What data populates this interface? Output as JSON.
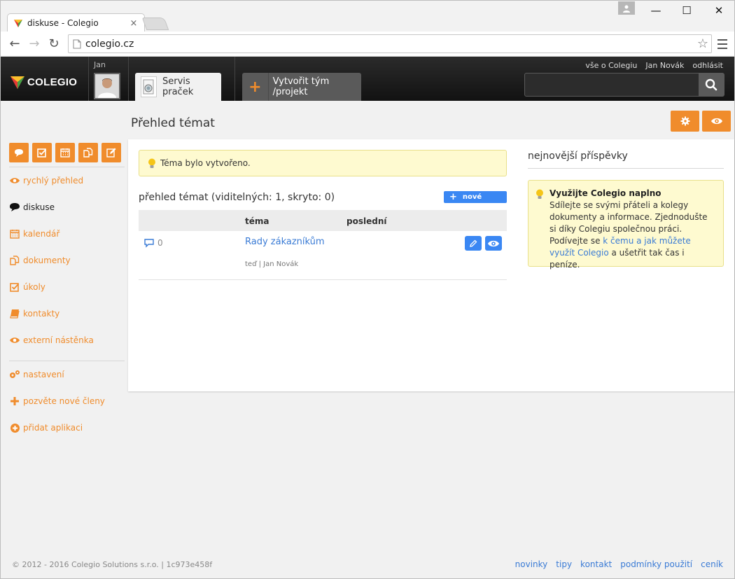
{
  "browser": {
    "tab_title": "diskuse - Colegio",
    "tab_close": "×",
    "url": "colegio.cz",
    "back": "←",
    "forward": "→",
    "reload": "↻",
    "star": "☆",
    "win_minimize": "—",
    "win_maximize": "☐",
    "win_close": "✕"
  },
  "header": {
    "logo_text": "COLEGIO",
    "user_label": "Jan",
    "team_tab_label": "Servis praček",
    "create_label": "Vytvořit tým /projekt",
    "create_plus": "+",
    "top_links": [
      "vše o Colegiu",
      "Jan Novák",
      "odhlásit"
    ],
    "search_placeholder": ""
  },
  "sidebar": {
    "items": [
      {
        "label": "rychlý přehled",
        "icon": "eye-icon"
      },
      {
        "label": "diskuse",
        "icon": "speech-bubble-icon"
      },
      {
        "label": "kalendář",
        "icon": "calendar-icon"
      },
      {
        "label": "dokumenty",
        "icon": "documents-icon"
      },
      {
        "label": "úkoly",
        "icon": "checkbox-icon"
      },
      {
        "label": "kontakty",
        "icon": "book-icon"
      },
      {
        "label": "externí nástěnka",
        "icon": "eye-icon"
      }
    ],
    "settings_items": [
      {
        "label": "nastavení",
        "icon": "gears-icon"
      },
      {
        "label": "pozvěte nové členy",
        "icon": "plus-icon"
      },
      {
        "label": "přidat aplikaci",
        "icon": "plus-circle-icon"
      }
    ]
  },
  "main": {
    "page_title": "Přehled témat",
    "alert_text": "Téma bylo vytvořeno.",
    "list_title": "přehled témat (viditelných: 1, skryto: 0)",
    "new_button": "nové",
    "columns": [
      "téma",
      "poslední"
    ],
    "rows": [
      {
        "count": "0",
        "title": "Rady zákazníkům",
        "meta": "teď | Jan Novák"
      }
    ]
  },
  "side": {
    "title": "nejnovější příspěvky",
    "tip_title": "Využijte Colegio naplno",
    "tip_text": "Sdílejte se svými přáteli a kolegy dokumenty a informace. Zjednodušte si díky Colegiu společnou práci.",
    "tip_text2": "Podívejte se ",
    "tip_link": "k čemu a jak můžete využít Colegio",
    "tip_text3": " a ušetřit tak čas i peníze."
  },
  "footer": {
    "copyright": "© 2012 - 2016 Colegio Solutions s.r.o. | 1c973e458f",
    "links": [
      "novinky",
      "tipy",
      "kontakt",
      "podmínky použití",
      "ceník"
    ]
  },
  "colors": {
    "accent": "#f08c2c",
    "link": "#3a7bd5",
    "button_blue": "#3a87f3",
    "alert_bg": "#fefad0"
  }
}
